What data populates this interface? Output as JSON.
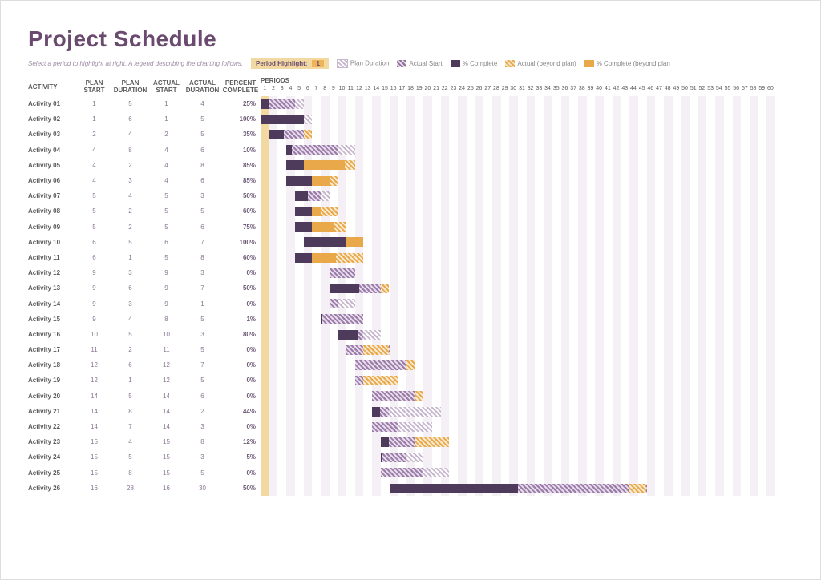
{
  "title": "Project Schedule",
  "hint": "Select a period to highlight at right.  A legend describing the charting follows.",
  "period_highlight_label": "Period Highlight:",
  "period_highlight_value": "1",
  "legend": {
    "plan": "Plan Duration",
    "actual": "Actual Start",
    "complete": "% Complete",
    "beyond": "Actual (beyond plan)",
    "cbeyond": "% Complete (beyond plan"
  },
  "columns": {
    "activity": "ACTIVITY",
    "plan_start": "PLAN START",
    "plan_dur": "PLAN DURATION",
    "actual_start": "ACTUAL START",
    "actual_dur": "ACTUAL DURATION",
    "percent": "PERCENT COMPLETE",
    "periods": "PERIODS"
  },
  "periods": 60,
  "chart_data": {
    "type": "bar",
    "title": "Project Schedule",
    "xlabel": "Periods",
    "ylabel": "Activity",
    "xlim": [
      1,
      60
    ],
    "rows": [
      {
        "name": "Activity 01",
        "plan_start": 1,
        "plan_dur": 5,
        "actual_start": 1,
        "actual_dur": 4,
        "pct": 25
      },
      {
        "name": "Activity 02",
        "plan_start": 1,
        "plan_dur": 6,
        "actual_start": 1,
        "actual_dur": 5,
        "pct": 100
      },
      {
        "name": "Activity 03",
        "plan_start": 2,
        "plan_dur": 4,
        "actual_start": 2,
        "actual_dur": 5,
        "pct": 35
      },
      {
        "name": "Activity 04",
        "plan_start": 4,
        "plan_dur": 8,
        "actual_start": 4,
        "actual_dur": 6,
        "pct": 10
      },
      {
        "name": "Activity 05",
        "plan_start": 4,
        "plan_dur": 2,
        "actual_start": 4,
        "actual_dur": 8,
        "pct": 85
      },
      {
        "name": "Activity 06",
        "plan_start": 4,
        "plan_dur": 3,
        "actual_start": 4,
        "actual_dur": 6,
        "pct": 85
      },
      {
        "name": "Activity 07",
        "plan_start": 5,
        "plan_dur": 4,
        "actual_start": 5,
        "actual_dur": 3,
        "pct": 50
      },
      {
        "name": "Activity 08",
        "plan_start": 5,
        "plan_dur": 2,
        "actual_start": 5,
        "actual_dur": 5,
        "pct": 60
      },
      {
        "name": "Activity 09",
        "plan_start": 5,
        "plan_dur": 2,
        "actual_start": 5,
        "actual_dur": 6,
        "pct": 75
      },
      {
        "name": "Activity 10",
        "plan_start": 6,
        "plan_dur": 5,
        "actual_start": 6,
        "actual_dur": 7,
        "pct": 100
      },
      {
        "name": "Activity 11",
        "plan_start": 6,
        "plan_dur": 1,
        "actual_start": 5,
        "actual_dur": 8,
        "pct": 60
      },
      {
        "name": "Activity 12",
        "plan_start": 9,
        "plan_dur": 3,
        "actual_start": 9,
        "actual_dur": 3,
        "pct": 0
      },
      {
        "name": "Activity 13",
        "plan_start": 9,
        "plan_dur": 6,
        "actual_start": 9,
        "actual_dur": 7,
        "pct": 50
      },
      {
        "name": "Activity 14",
        "plan_start": 9,
        "plan_dur": 3,
        "actual_start": 9,
        "actual_dur": 1,
        "pct": 0
      },
      {
        "name": "Activity 15",
        "plan_start": 9,
        "plan_dur": 4,
        "actual_start": 8,
        "actual_dur": 5,
        "pct": 1
      },
      {
        "name": "Activity 16",
        "plan_start": 10,
        "plan_dur": 5,
        "actual_start": 10,
        "actual_dur": 3,
        "pct": 80
      },
      {
        "name": "Activity 17",
        "plan_start": 11,
        "plan_dur": 2,
        "actual_start": 11,
        "actual_dur": 5,
        "pct": 0
      },
      {
        "name": "Activity 18",
        "plan_start": 12,
        "plan_dur": 6,
        "actual_start": 12,
        "actual_dur": 7,
        "pct": 0
      },
      {
        "name": "Activity 19",
        "plan_start": 12,
        "plan_dur": 1,
        "actual_start": 12,
        "actual_dur": 5,
        "pct": 0
      },
      {
        "name": "Activity 20",
        "plan_start": 14,
        "plan_dur": 5,
        "actual_start": 14,
        "actual_dur": 6,
        "pct": 0
      },
      {
        "name": "Activity 21",
        "plan_start": 14,
        "plan_dur": 8,
        "actual_start": 14,
        "actual_dur": 2,
        "pct": 44
      },
      {
        "name": "Activity 22",
        "plan_start": 14,
        "plan_dur": 7,
        "actual_start": 14,
        "actual_dur": 3,
        "pct": 0
      },
      {
        "name": "Activity 23",
        "plan_start": 15,
        "plan_dur": 4,
        "actual_start": 15,
        "actual_dur": 8,
        "pct": 12
      },
      {
        "name": "Activity 24",
        "plan_start": 15,
        "plan_dur": 5,
        "actual_start": 15,
        "actual_dur": 3,
        "pct": 5
      },
      {
        "name": "Activity 25",
        "plan_start": 15,
        "plan_dur": 8,
        "actual_start": 15,
        "actual_dur": 5,
        "pct": 0
      },
      {
        "name": "Activity 26",
        "plan_start": 16,
        "plan_dur": 28,
        "actual_start": 16,
        "actual_dur": 30,
        "pct": 50
      }
    ]
  }
}
